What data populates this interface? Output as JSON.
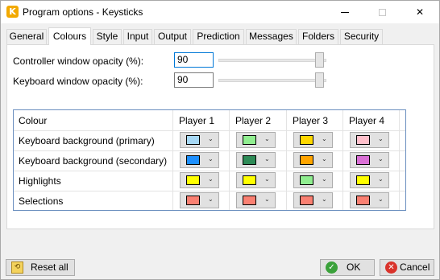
{
  "window": {
    "title": "Program options - Keysticks",
    "app_icon_letter": "K",
    "minimize_icon": "minimize-icon",
    "maximize_icon": "maximize-icon",
    "close_glyph": "✕"
  },
  "tabs": [
    {
      "label": "General",
      "active": false
    },
    {
      "label": "Colours",
      "active": true
    },
    {
      "label": "Style",
      "active": false
    },
    {
      "label": "Input",
      "active": false
    },
    {
      "label": "Output",
      "active": false
    },
    {
      "label": "Prediction",
      "active": false
    },
    {
      "label": "Messages",
      "active": false
    },
    {
      "label": "Folders",
      "active": false
    },
    {
      "label": "Security",
      "active": false
    }
  ],
  "opacity": {
    "controller_label": "Controller window opacity (%):",
    "controller_value": "90",
    "keyboard_label": "Keyboard window opacity (%):",
    "keyboard_value": "90"
  },
  "colour_table": {
    "header": {
      "colour": "Colour",
      "players": [
        "Player 1",
        "Player 2",
        "Player 3",
        "Player 4"
      ]
    },
    "rows": [
      {
        "label": "Keyboard background (primary)",
        "colors": [
          "#a6d8f5",
          "#90ee90",
          "#ffd700",
          "#ffc0cb"
        ]
      },
      {
        "label": "Keyboard background (secondary)",
        "colors": [
          "#1e90ff",
          "#2e8b57",
          "#ffa500",
          "#da70d6"
        ]
      },
      {
        "label": "Highlights",
        "colors": [
          "#ffff00",
          "#ffff00",
          "#90ee90",
          "#ffff00"
        ]
      },
      {
        "label": "Selections",
        "colors": [
          "#fa8072",
          "#fa8072",
          "#fa8072",
          "#fa8072"
        ]
      }
    ],
    "dropdown_glyph": "⌄"
  },
  "buttons": {
    "reset_all": "Reset all",
    "ok": "OK",
    "cancel": "Cancel",
    "ok_glyph": "✓",
    "cancel_glyph": "✕"
  }
}
